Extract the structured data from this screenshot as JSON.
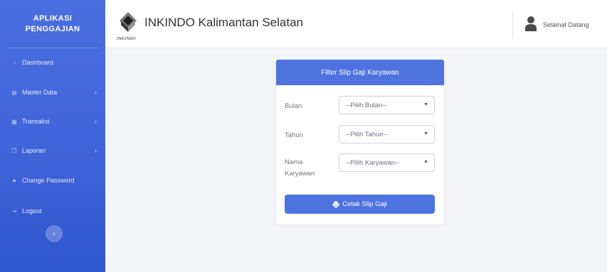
{
  "sidebar": {
    "brand_line1": "APLIKASI",
    "brand_line2": "PENGGAJIAN",
    "items": [
      {
        "label": "Dashboard",
        "icon": "dashboard-icon"
      },
      {
        "label": "Master Data",
        "icon": "database-icon",
        "has_submenu": true
      },
      {
        "label": "Transaksi",
        "icon": "table-icon",
        "has_submenu": true
      },
      {
        "label": "Laporan",
        "icon": "copy-icon",
        "has_submenu": true
      },
      {
        "label": "Change Password",
        "icon": "lock-icon"
      },
      {
        "label": "Logout",
        "icon": "sign-out-icon"
      }
    ],
    "collapse_icon": "‹"
  },
  "topbar": {
    "logo_caption": "INKINDO",
    "title": "INKINDO Kalimantan Selatan",
    "greeting": "Selamat Datang"
  },
  "form": {
    "header": "Filter Slip Gaji Karyawan",
    "bulan_label": "Bulan",
    "bulan_value": "--Pilih Bulan--",
    "tahun_label": "Tahun",
    "tahun_value": "--Pilih Tahun--",
    "nama_label_line1": "Nama",
    "nama_label_line2": "Karyawan",
    "nama_value": "--Pilih Karyawan--",
    "submit_label": "Cetak Slip Gaji"
  },
  "colors": {
    "primary": "#4e73df",
    "sidebar": "#4065db"
  }
}
